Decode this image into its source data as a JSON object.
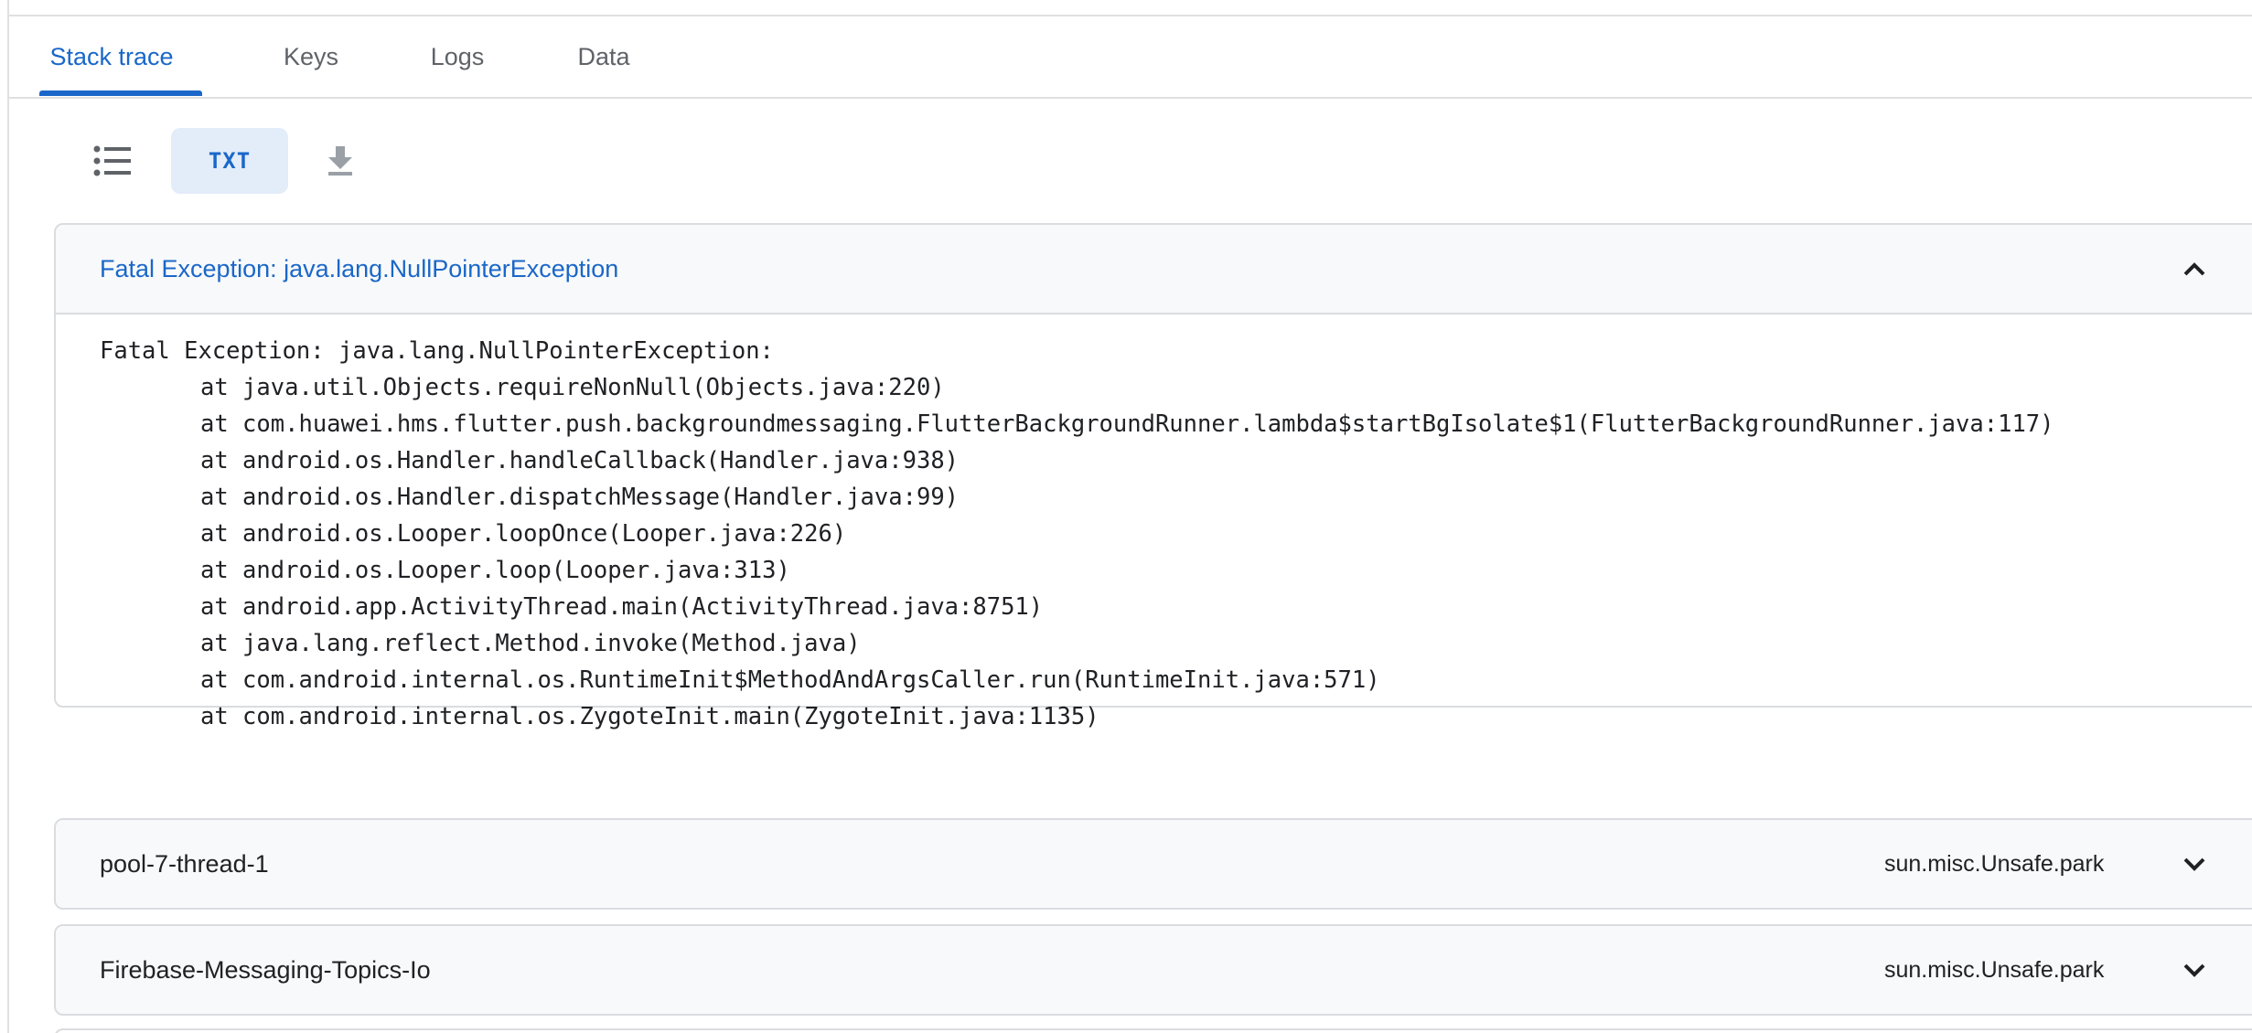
{
  "tabs": [
    {
      "label": "Stack trace",
      "active": true
    },
    {
      "label": "Keys",
      "active": false
    },
    {
      "label": "Logs",
      "active": false
    },
    {
      "label": "Data",
      "active": false
    }
  ],
  "toolbar": {
    "list_icon": "list-icon",
    "txt_label": "TXT",
    "download_icon": "download-icon"
  },
  "exception_panel": {
    "title": "Fatal Exception: java.lang.NullPointerException",
    "expanded": true,
    "header_line": "Fatal Exception: java.lang.NullPointerException:",
    "frames": [
      "at java.util.Objects.requireNonNull(Objects.java:220)",
      "at com.huawei.hms.flutter.push.backgroundmessaging.FlutterBackgroundRunner.lambda$startBgIsolate$1(FlutterBackgroundRunner.java:117)",
      "at android.os.Handler.handleCallback(Handler.java:938)",
      "at android.os.Handler.dispatchMessage(Handler.java:99)",
      "at android.os.Looper.loopOnce(Looper.java:226)",
      "at android.os.Looper.loop(Looper.java:313)",
      "at android.app.ActivityThread.main(ActivityThread.java:8751)",
      "at java.lang.reflect.Method.invoke(Method.java)",
      "at com.android.internal.os.RuntimeInit$MethodAndArgsCaller.run(RuntimeInit.java:571)",
      "at com.android.internal.os.ZygoteInit.main(ZygoteInit.java:1135)"
    ]
  },
  "threads": [
    {
      "name": "pool-7-thread-1",
      "top_frame": "sun.misc.Unsafe.park",
      "expanded": false
    },
    {
      "name": "Firebase-Messaging-Topics-Io",
      "top_frame": "sun.misc.Unsafe.park",
      "expanded": false
    }
  ],
  "colors": {
    "accent": "#1a67c9",
    "txt_button_bg": "#e3ecf9",
    "panel_header_bg": "#f8f9fa",
    "border": "#dadce0",
    "icon_gray": "#5f6368"
  }
}
